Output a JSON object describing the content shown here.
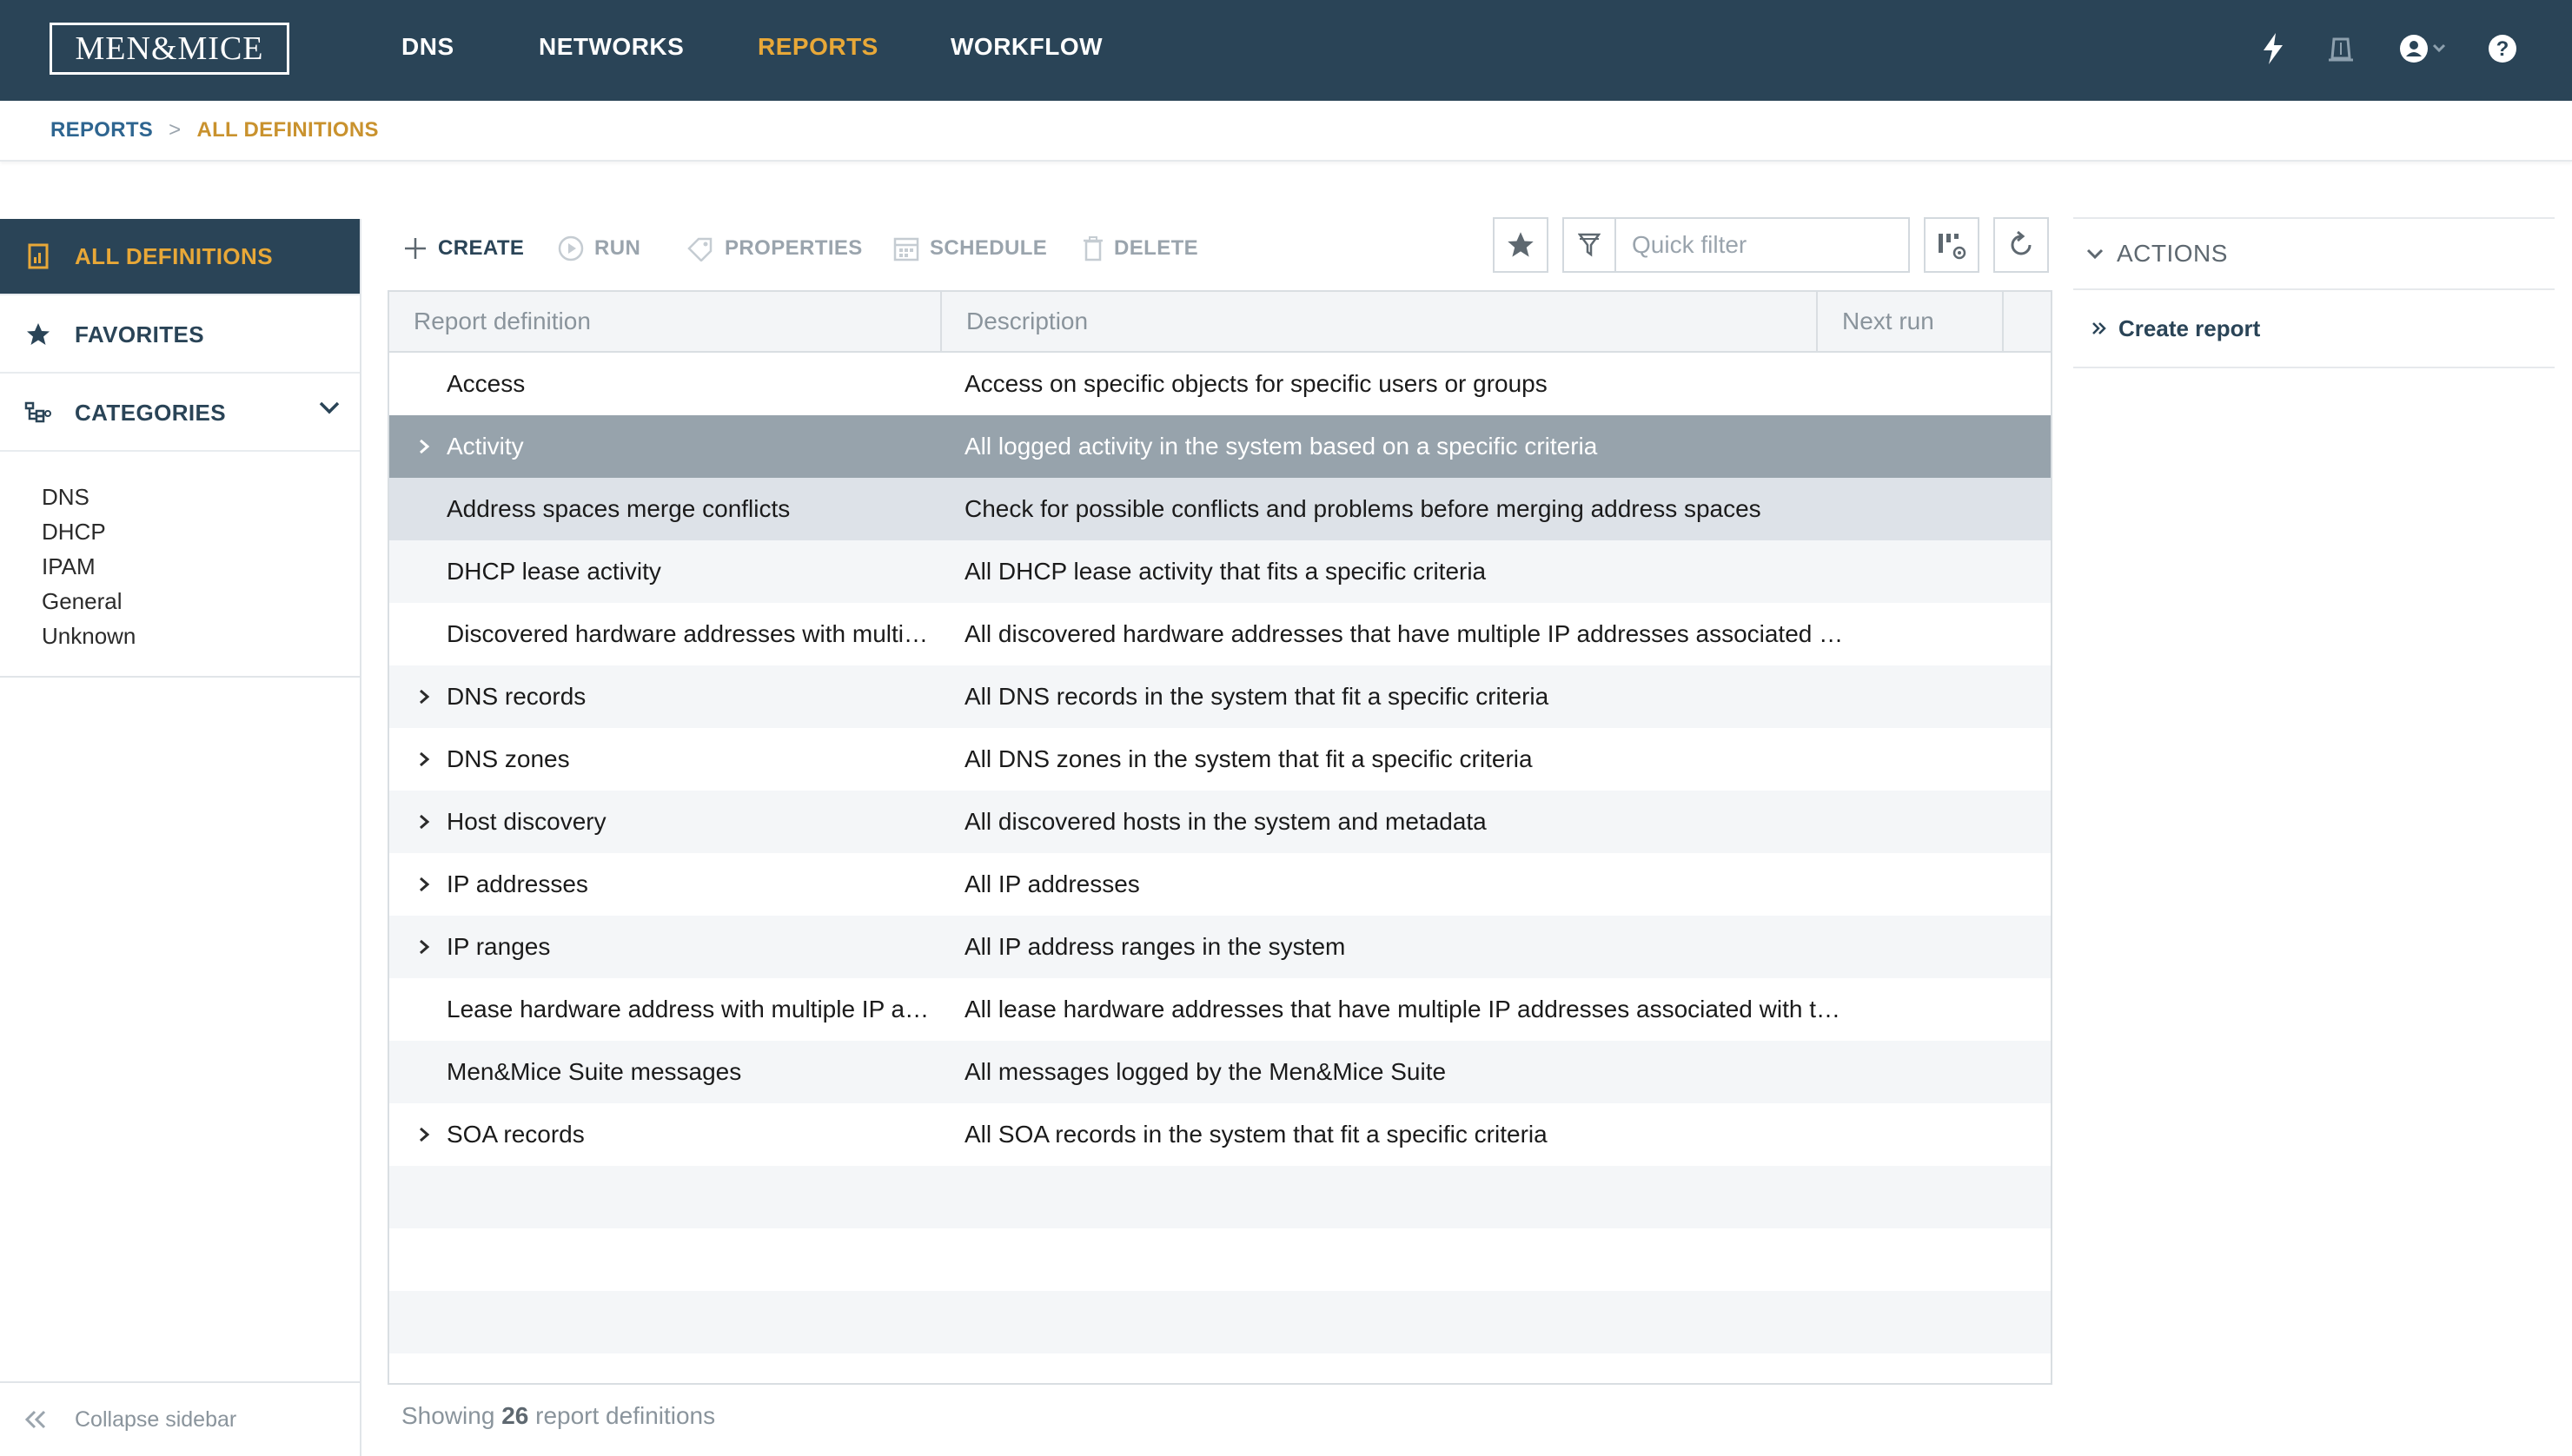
{
  "brand": {
    "logo_text": "MEN&MICE"
  },
  "nav": [
    {
      "label": "DNS",
      "active": false
    },
    {
      "label": "NETWORKS",
      "active": false
    },
    {
      "label": "REPORTS",
      "active": true
    },
    {
      "label": "WORKFLOW",
      "active": false
    }
  ],
  "top_icons": [
    "lightning-icon",
    "alert-bell-icon",
    "user-account-icon",
    "help-icon"
  ],
  "breadcrumb": {
    "root": "REPORTS",
    "separator": ">",
    "current": "ALL DEFINITIONS"
  },
  "sidebar": {
    "items": [
      {
        "label": "ALL DEFINITIONS",
        "icon": "report-document-icon",
        "active": true
      },
      {
        "label": "FAVORITES",
        "icon": "star-icon",
        "active": false
      },
      {
        "label": "CATEGORIES",
        "icon": "category-tree-icon",
        "active": false
      }
    ],
    "categories": [
      "DNS",
      "DHCP",
      "IPAM",
      "General",
      "Unknown"
    ],
    "collapse_label": "Collapse sidebar"
  },
  "toolbar": {
    "create": "CREATE",
    "run": "RUN",
    "properties": "PROPERTIES",
    "schedule": "SCHEDULE",
    "delete": "DELETE",
    "filter_placeholder": "Quick filter"
  },
  "grid": {
    "columns": [
      "Report definition",
      "Description",
      "Next run"
    ],
    "rows": [
      {
        "name": "Access",
        "description": "Access on specific objects for specific users or groups",
        "expandable": false
      },
      {
        "name": "Activity",
        "description": "All logged activity in the system based on a specific criteria",
        "expandable": true
      },
      {
        "name": "Address spaces merge conflicts",
        "description": "Check for possible conflicts and problems before merging address spaces",
        "expandable": false
      },
      {
        "name": "DHCP lease activity",
        "description": "All DHCP lease activity that fits a specific criteria",
        "expandable": false
      },
      {
        "name": "Discovered hardware addresses with multi…",
        "description": "All discovered hardware addresses that have multiple IP addresses associated …",
        "expandable": false
      },
      {
        "name": "DNS records",
        "description": "All DNS records in the system that fit a specific criteria",
        "expandable": true
      },
      {
        "name": "DNS zones",
        "description": "All DNS zones in the system that fit a specific criteria",
        "expandable": true
      },
      {
        "name": "Host discovery",
        "description": "All discovered hosts in the system and metadata",
        "expandable": true
      },
      {
        "name": "IP addresses",
        "description": "All IP addresses",
        "expandable": true
      },
      {
        "name": "IP ranges",
        "description": "All IP address ranges in the system",
        "expandable": true
      },
      {
        "name": "Lease hardware address with multiple IP a…",
        "description": "All lease hardware addresses that have multiple IP addresses associated with t…",
        "expandable": false
      },
      {
        "name": "Men&Mice Suite messages",
        "description": "All messages logged by the Men&Mice Suite",
        "expandable": false
      },
      {
        "name": "SOA records",
        "description": "All SOA records in the system that fit a specific criteria",
        "expandable": true
      }
    ]
  },
  "footer": {
    "prefix": "Showing",
    "count": "26",
    "suffix": "report definitions"
  },
  "actions": {
    "title": "ACTIONS",
    "links": [
      "Create report"
    ]
  },
  "colors": {
    "topbar": "#2a4457",
    "accent": "#e8a838",
    "selected_row": "#97a3ac"
  }
}
